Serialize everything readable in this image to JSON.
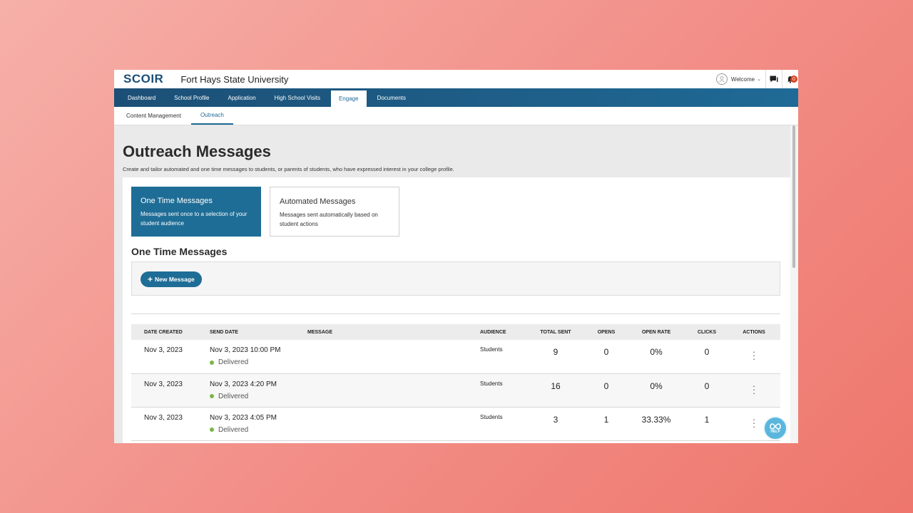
{
  "header": {
    "logo": "SCOIR",
    "school_name": "Fort Hays State University",
    "welcome": "Welcome",
    "notification_count": "0"
  },
  "main_nav": [
    {
      "label": "Dashboard",
      "active": false
    },
    {
      "label": "School Profile",
      "active": false
    },
    {
      "label": "Application",
      "active": false
    },
    {
      "label": "High School Visits",
      "active": false
    },
    {
      "label": "Engage",
      "active": true
    },
    {
      "label": "Documents",
      "active": false
    }
  ],
  "sub_nav": [
    {
      "label": "Content Management",
      "active": false
    },
    {
      "label": "Outreach",
      "active": true
    }
  ],
  "page": {
    "title": "Outreach Messages",
    "description": "Create and tailor automated and one time messages to students, or parents of students, who have expressed interest in your college profile."
  },
  "cards": [
    {
      "title": "One Time Messages",
      "description": "Messages sent once to a selection of your student audience",
      "active": true
    },
    {
      "title": "Automated Messages",
      "description": "Messages sent automatically based on student actions",
      "active": false
    }
  ],
  "section_title": "One Time Messages",
  "new_message_label": "New Message",
  "table": {
    "headers": [
      "DATE CREATED",
      "SEND DATE",
      "MESSAGE",
      "AUDIENCE",
      "TOTAL SENT",
      "OPENS",
      "OPEN RATE",
      "CLICKS",
      "ACTIONS"
    ],
    "rows": [
      {
        "date_created": "Nov 3, 2023",
        "send_date": "Nov 3, 2023 10:00 PM",
        "status": "Delivered",
        "message": "",
        "audience": "Students",
        "total_sent": "9",
        "opens": "0",
        "open_rate": "0%",
        "clicks": "0"
      },
      {
        "date_created": "Nov 3, 2023",
        "send_date": "Nov 3, 2023 4:20 PM",
        "status": "Delivered",
        "message": "",
        "audience": "Students",
        "total_sent": "16",
        "opens": "0",
        "open_rate": "0%",
        "clicks": "0"
      },
      {
        "date_created": "Nov 3, 2023",
        "send_date": "Nov 3, 2023 4:05 PM",
        "status": "Delivered",
        "message": "",
        "audience": "Students",
        "total_sent": "3",
        "opens": "1",
        "open_rate": "33.33%",
        "clicks": "1"
      }
    ]
  },
  "help_label": "HELP",
  "colors": {
    "brand": "#1e6d96",
    "nav_dark": "#1c4f76",
    "delivered": "#7ab648",
    "badge": "#d9411e"
  }
}
